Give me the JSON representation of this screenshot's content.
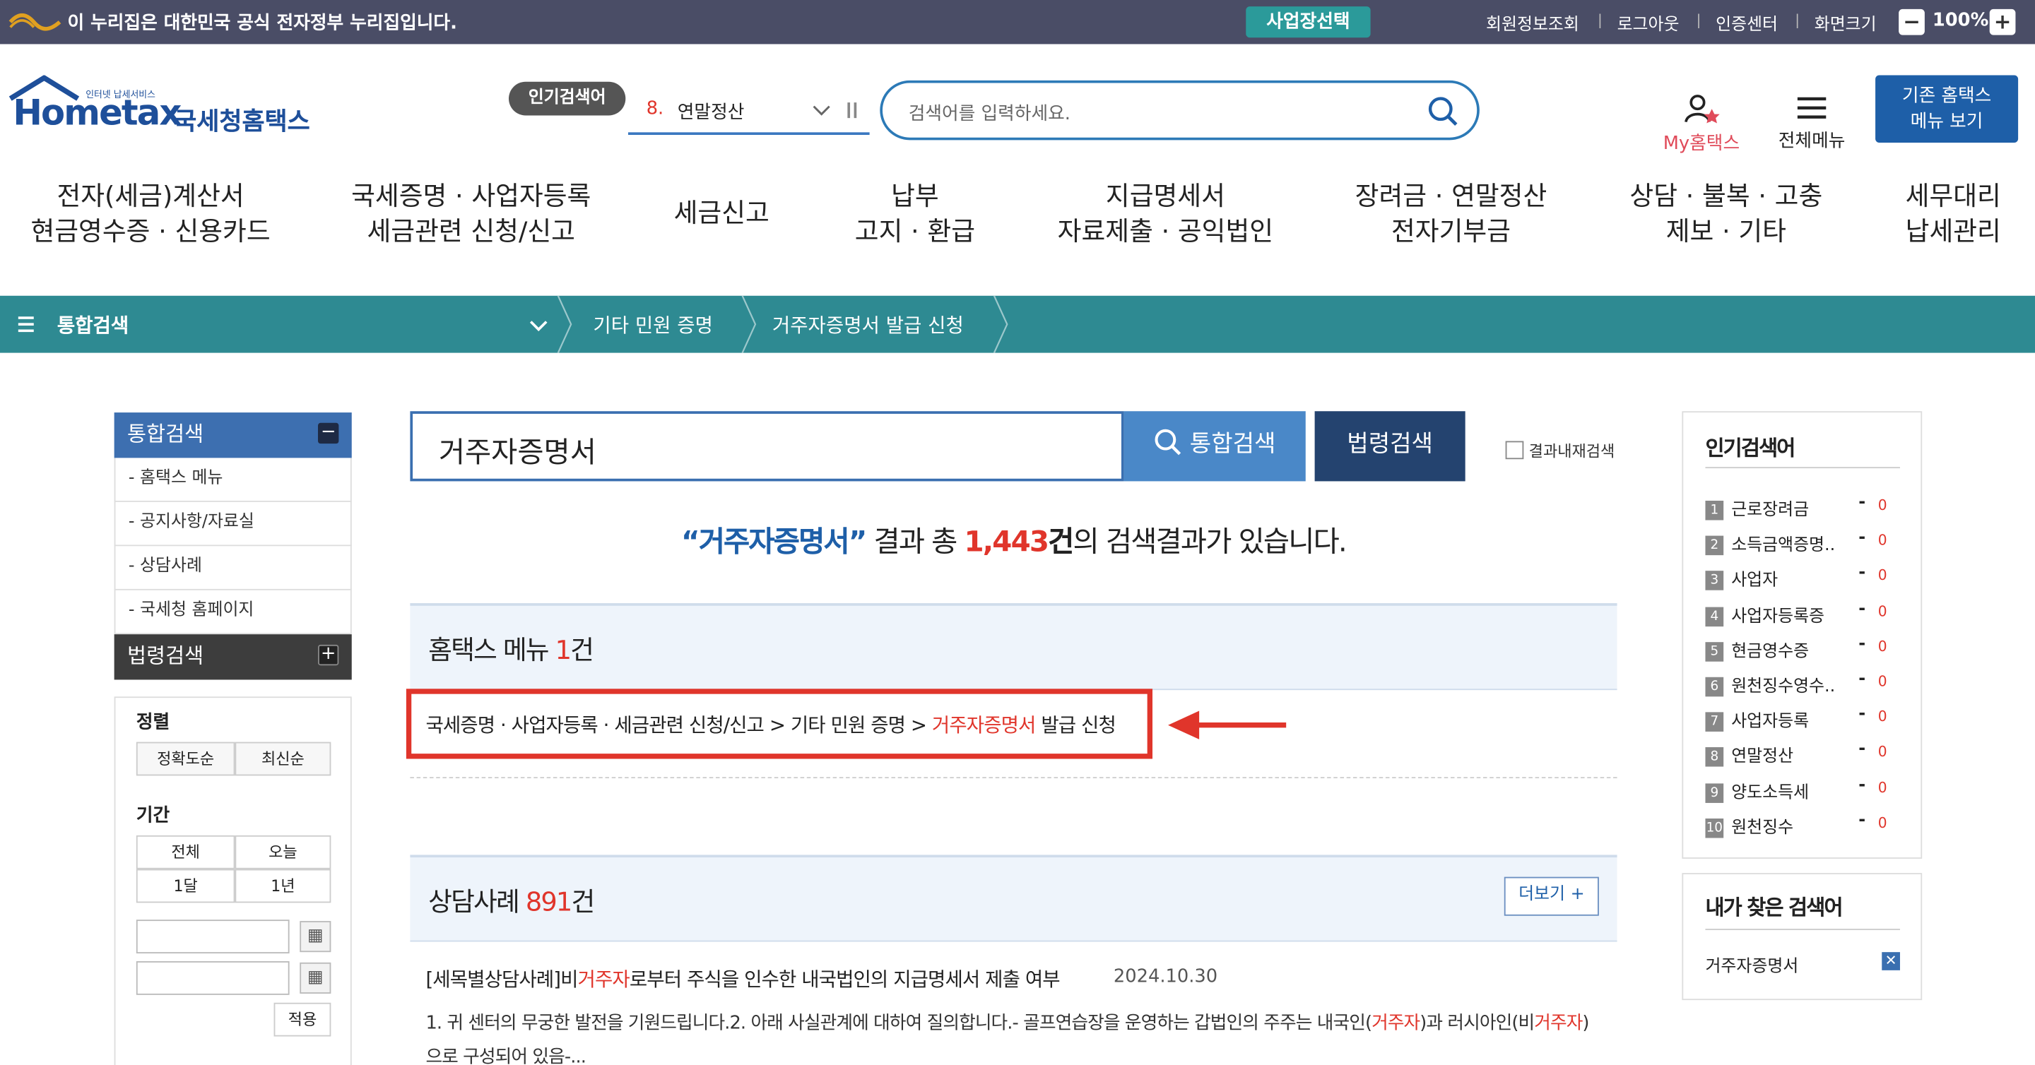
{
  "gov_banner": {
    "message": "이 누리집은 대한민국 공식 전자정부 누리집입니다.",
    "business_select": "사업장선택",
    "links": [
      "회원정보조회",
      "로그아웃",
      "인증센터",
      "화면크기"
    ],
    "zoom": "100%"
  },
  "header": {
    "logo_word": "Hometax",
    "logo_small": "인터넷 납세서비스",
    "logo_kor": "국세청홈택스",
    "popular_badge": "인기검색어",
    "popular_rank_no": "8.",
    "popular_rank_term": "연말정산",
    "search_placeholder": "검색어를 입력하세요.",
    "my_hometax": "My홈택스",
    "all_menu": "전체메뉴",
    "old_hometax_line1": "기존 홈택스",
    "old_hometax_line2": "메뉴 보기"
  },
  "gnb": [
    {
      "l1": "전자(세금)계산서",
      "l2": "현금영수증 · 신용카드"
    },
    {
      "l1": "국세증명 · 사업자등록",
      "l2": "세금관련 신청/신고"
    },
    {
      "l1": "세금신고",
      "l2": ""
    },
    {
      "l1": "납부",
      "l2": "고지 · 환급"
    },
    {
      "l1": "지급명세서",
      "l2": "자료제출 · 공익법인"
    },
    {
      "l1": "장려금 · 연말정산",
      "l2": "전자기부금"
    },
    {
      "l1": "상담 · 불복 · 고충",
      "l2": "제보 · 기타"
    },
    {
      "l1": "세무대리",
      "l2": "납세관리"
    }
  ],
  "breadcrumb": {
    "root": "통합검색",
    "items": [
      "기타 민원 증명",
      "거주자증명서 발급 신청"
    ]
  },
  "left_sidebar": {
    "integrated_title": "통합검색",
    "items": [
      "- 홈택스 메뉴",
      "- 공지사항/자료실",
      "- 상담사례",
      "- 국세청 홈페이지"
    ],
    "law_title": "법령검색",
    "sort_title": "정렬",
    "sort_options": [
      "정확도순",
      "최신순"
    ],
    "period_title": "기간",
    "period_options": [
      "전체",
      "오늘",
      "1달",
      "1년"
    ],
    "apply": "적용"
  },
  "main": {
    "query": "거주자증명서",
    "search_button": "통합검색",
    "law_button": "법령검색",
    "in_result": "결과내재검색",
    "summary_term": "“거주자증명서”",
    "summary_mid": " 결과 총 ",
    "summary_count": "1,443",
    "summary_unit": "건",
    "summary_tail": "의 검색결과가 있습니다.",
    "menu_section_label": "홈택스 메뉴 ",
    "menu_section_count": "1",
    "menu_section_unit": "건",
    "menu_path_prefix": "국세증명 · 사업자등록 · 세금관련 신청/신고 > 기타 민원 증명 > ",
    "menu_path_highlight": "거주자증명서",
    "menu_path_suffix": " 발급 신청",
    "consult_section_label": "상담사례 ",
    "consult_section_count": "891",
    "consult_section_unit": "건",
    "more_button": "더보기",
    "post_title_pre": "[세목별상담사례]비",
    "post_title_hl": "거주자",
    "post_title_post": "로부터 주식을 인수한 내국법인의 지급명세서 제출 여부",
    "post_date": "2024.10.30",
    "post_body_1": "1. 귀 센터의 무궁한 발전을 기원드립니다.2. 아래 사실관계에 대하여 질의합니다.- 골프연습장을 운영하는 갑법인의 주주는 내국인(",
    "post_body_hl1": "거주자",
    "post_body_2": ")과 러시아인(비",
    "post_body_hl2": "거주자",
    "post_body_3": ")으로 구성되어 있음-..."
  },
  "right_sidebar": {
    "popular_title": "인기검색어",
    "popular": [
      {
        "rank": "1",
        "term": "근로장려금",
        "change": "0"
      },
      {
        "rank": "2",
        "term": "소득금액증명..",
        "change": "0"
      },
      {
        "rank": "3",
        "term": "사업자",
        "change": "0"
      },
      {
        "rank": "4",
        "term": "사업자등록증",
        "change": "0"
      },
      {
        "rank": "5",
        "term": "현금영수증",
        "change": "0"
      },
      {
        "rank": "6",
        "term": "원천징수영수..",
        "change": "0"
      },
      {
        "rank": "7",
        "term": "사업자등록",
        "change": "0"
      },
      {
        "rank": "8",
        "term": "연말정산",
        "change": "0"
      },
      {
        "rank": "9",
        "term": "양도소득세",
        "change": "0"
      },
      {
        "rank": "10",
        "term": "원천징수",
        "change": "0"
      }
    ],
    "my_title": "내가 찾은 검색어",
    "my_keyword": "거주자증명서"
  },
  "colors": {
    "accent_blue": "#1e5fa8",
    "teal_bar": "#2e8a92",
    "highlight_red": "#e0352b"
  }
}
